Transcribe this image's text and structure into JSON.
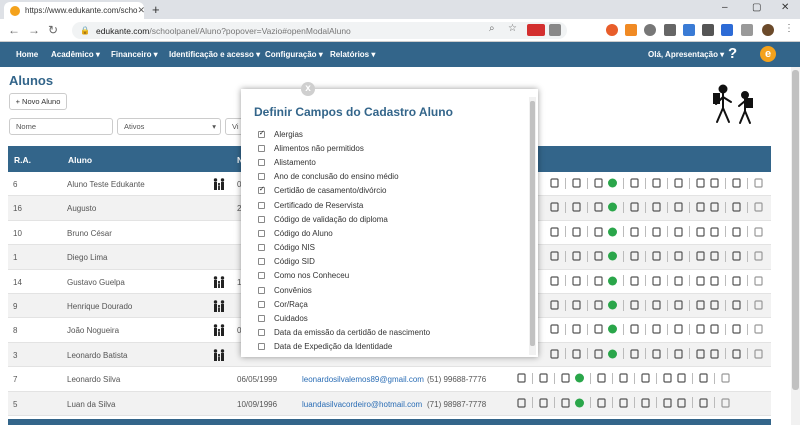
{
  "browser": {
    "tab_title": "https://www.edukante.com/scho",
    "new_tab": "+",
    "url_host": "edukante.com",
    "url_path": "/schoolpanel/Aluno?popover=Vazio#openModalAluno",
    "window_controls": [
      "–",
      "▢",
      "✕"
    ]
  },
  "nav": {
    "items": [
      {
        "label": "Home"
      },
      {
        "label": "Acadêmico ▾"
      },
      {
        "label": "Financeiro ▾"
      },
      {
        "label": "Identificação e acesso ▾"
      },
      {
        "label": "Configuração ▾"
      },
      {
        "label": "Relatórios ▾"
      }
    ],
    "user": "Olá, Apresentação ▾",
    "help": "?",
    "logo": "e"
  },
  "page": {
    "title": "Alunos",
    "new_button": "+ Novo Aluno",
    "filter_name_placeholder": "Nome",
    "filter_status": "Ativos",
    "filter_status_arrow": "▾",
    "filter_third": "Vi"
  },
  "table": {
    "headers": [
      "R.A.",
      "Aluno",
      "N"
    ],
    "rows": [
      {
        "ra": "6",
        "name": "Aluno Teste Edukante",
        "family": true,
        "birth": "0",
        "email": "",
        "phone": ""
      },
      {
        "ra": "16",
        "name": "Augusto",
        "family": false,
        "birth": "2",
        "email": "",
        "phone": ""
      },
      {
        "ra": "10",
        "name": "Bruno César",
        "family": false,
        "birth": "",
        "email": "",
        "phone": ""
      },
      {
        "ra": "1",
        "name": "Diego Lima",
        "family": false,
        "birth": "",
        "email": "",
        "phone": ""
      },
      {
        "ra": "14",
        "name": "Gustavo Guelpa",
        "family": true,
        "birth": "1",
        "email": "",
        "phone": ""
      },
      {
        "ra": "9",
        "name": "Henrique Dourado",
        "family": true,
        "birth": "",
        "email": "",
        "phone": ""
      },
      {
        "ra": "8",
        "name": "João Nogueira",
        "family": true,
        "birth": "0",
        "email": "",
        "phone": ""
      },
      {
        "ra": "3",
        "name": "Leonardo Batista",
        "family": true,
        "birth": "",
        "email": "",
        "phone": ""
      },
      {
        "ra": "7",
        "name": "Leonardo Silva",
        "family": false,
        "birth": "06/05/1999",
        "email": "leonardosilvalemos89@gmail.com",
        "phone": "(51) 99688-7776"
      },
      {
        "ra": "5",
        "name": "Luan da Silva",
        "family": false,
        "birth": "10/09/1996",
        "email": "luandasilvacordeiro@hotmail.com",
        "phone": "(71) 98987-7778"
      }
    ]
  },
  "modal": {
    "title": "Definir Campos do Cadastro Aluno",
    "close": "x",
    "options": [
      {
        "label": "Alergias",
        "checked": true
      },
      {
        "label": "Alimentos não permitidos",
        "checked": false
      },
      {
        "label": "Alistamento",
        "checked": false
      },
      {
        "label": "Ano de conclusão do ensino médio",
        "checked": false
      },
      {
        "label": "Certidão de casamento/divórcio",
        "checked": true
      },
      {
        "label": "Certificado de Reservista",
        "checked": false
      },
      {
        "label": "Código de validação do diploma",
        "checked": false
      },
      {
        "label": "Código do Aluno",
        "checked": false
      },
      {
        "label": "Código NIS",
        "checked": false
      },
      {
        "label": "Código SID",
        "checked": false
      },
      {
        "label": "Como nos Conheceu",
        "checked": false
      },
      {
        "label": "Convênios",
        "checked": false
      },
      {
        "label": "Cor/Raça",
        "checked": false
      },
      {
        "label": "Cuidados",
        "checked": false
      },
      {
        "label": "Data da emissão da certidão de nascimento",
        "checked": false
      },
      {
        "label": "Data de Expedição da Identidade",
        "checked": false
      }
    ]
  },
  "colors": {
    "primary": "#33658a",
    "accent": "#f4a21c",
    "link": "#2a6db5"
  }
}
